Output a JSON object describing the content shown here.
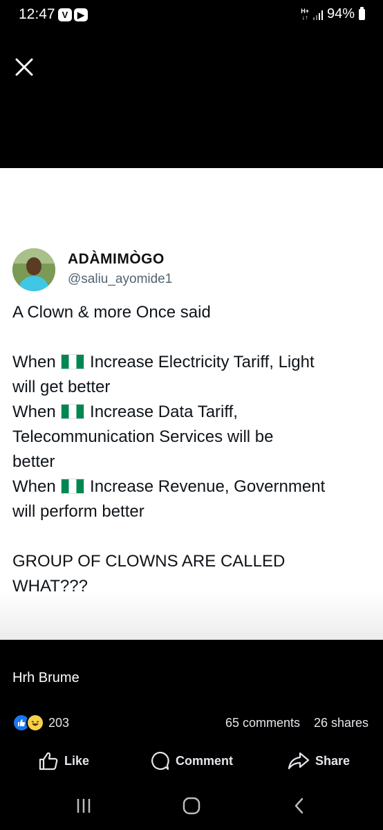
{
  "status_bar": {
    "time": "12:47",
    "app_icons": [
      "V",
      "▶"
    ],
    "network": "H+",
    "battery": "94%"
  },
  "post": {
    "author_name": "ADÀMIMÒGO",
    "author_handle": "@saliu_ayomide1",
    "text_lines": [
      {
        "before": "A Clown & more Once said",
        "flag": false,
        "after": ""
      },
      {
        "before": "",
        "flag": false,
        "after": ""
      },
      {
        "before": "When ",
        "flag": true,
        "after": " Increase Electricity Tariff, Light"
      },
      {
        "before": "will get better",
        "flag": false,
        "after": ""
      },
      {
        "before": "When ",
        "flag": true,
        "after": " Increase Data Tariff,"
      },
      {
        "before": "Telecommunication Services will be",
        "flag": false,
        "after": ""
      },
      {
        "before": "better",
        "flag": false,
        "after": ""
      },
      {
        "before": "When ",
        "flag": true,
        "after": " Increase Revenue, Government"
      },
      {
        "before": "will perform better",
        "flag": false,
        "after": ""
      },
      {
        "before": "",
        "flag": false,
        "after": ""
      },
      {
        "before": "GROUP OF CLOWNS ARE CALLED",
        "flag": false,
        "after": ""
      },
      {
        "before": "WHAT???",
        "flag": false,
        "after": ""
      }
    ]
  },
  "poster": {
    "name": "Hrh Brume"
  },
  "engagement": {
    "reaction_count": "203",
    "comments": "65 comments",
    "shares": "26 shares"
  },
  "actions": {
    "like": "Like",
    "comment": "Comment",
    "share": "Share"
  },
  "icons": {
    "close": "close-icon",
    "like": "thumbs-up-icon",
    "comment": "comment-bubble-icon",
    "share": "share-arrow-icon"
  },
  "colors": {
    "background": "#000000",
    "post_background": "#ffffff",
    "reaction_like": "#1877f2",
    "reaction_haha": "#f7d04b",
    "flag_green": "#008751"
  }
}
